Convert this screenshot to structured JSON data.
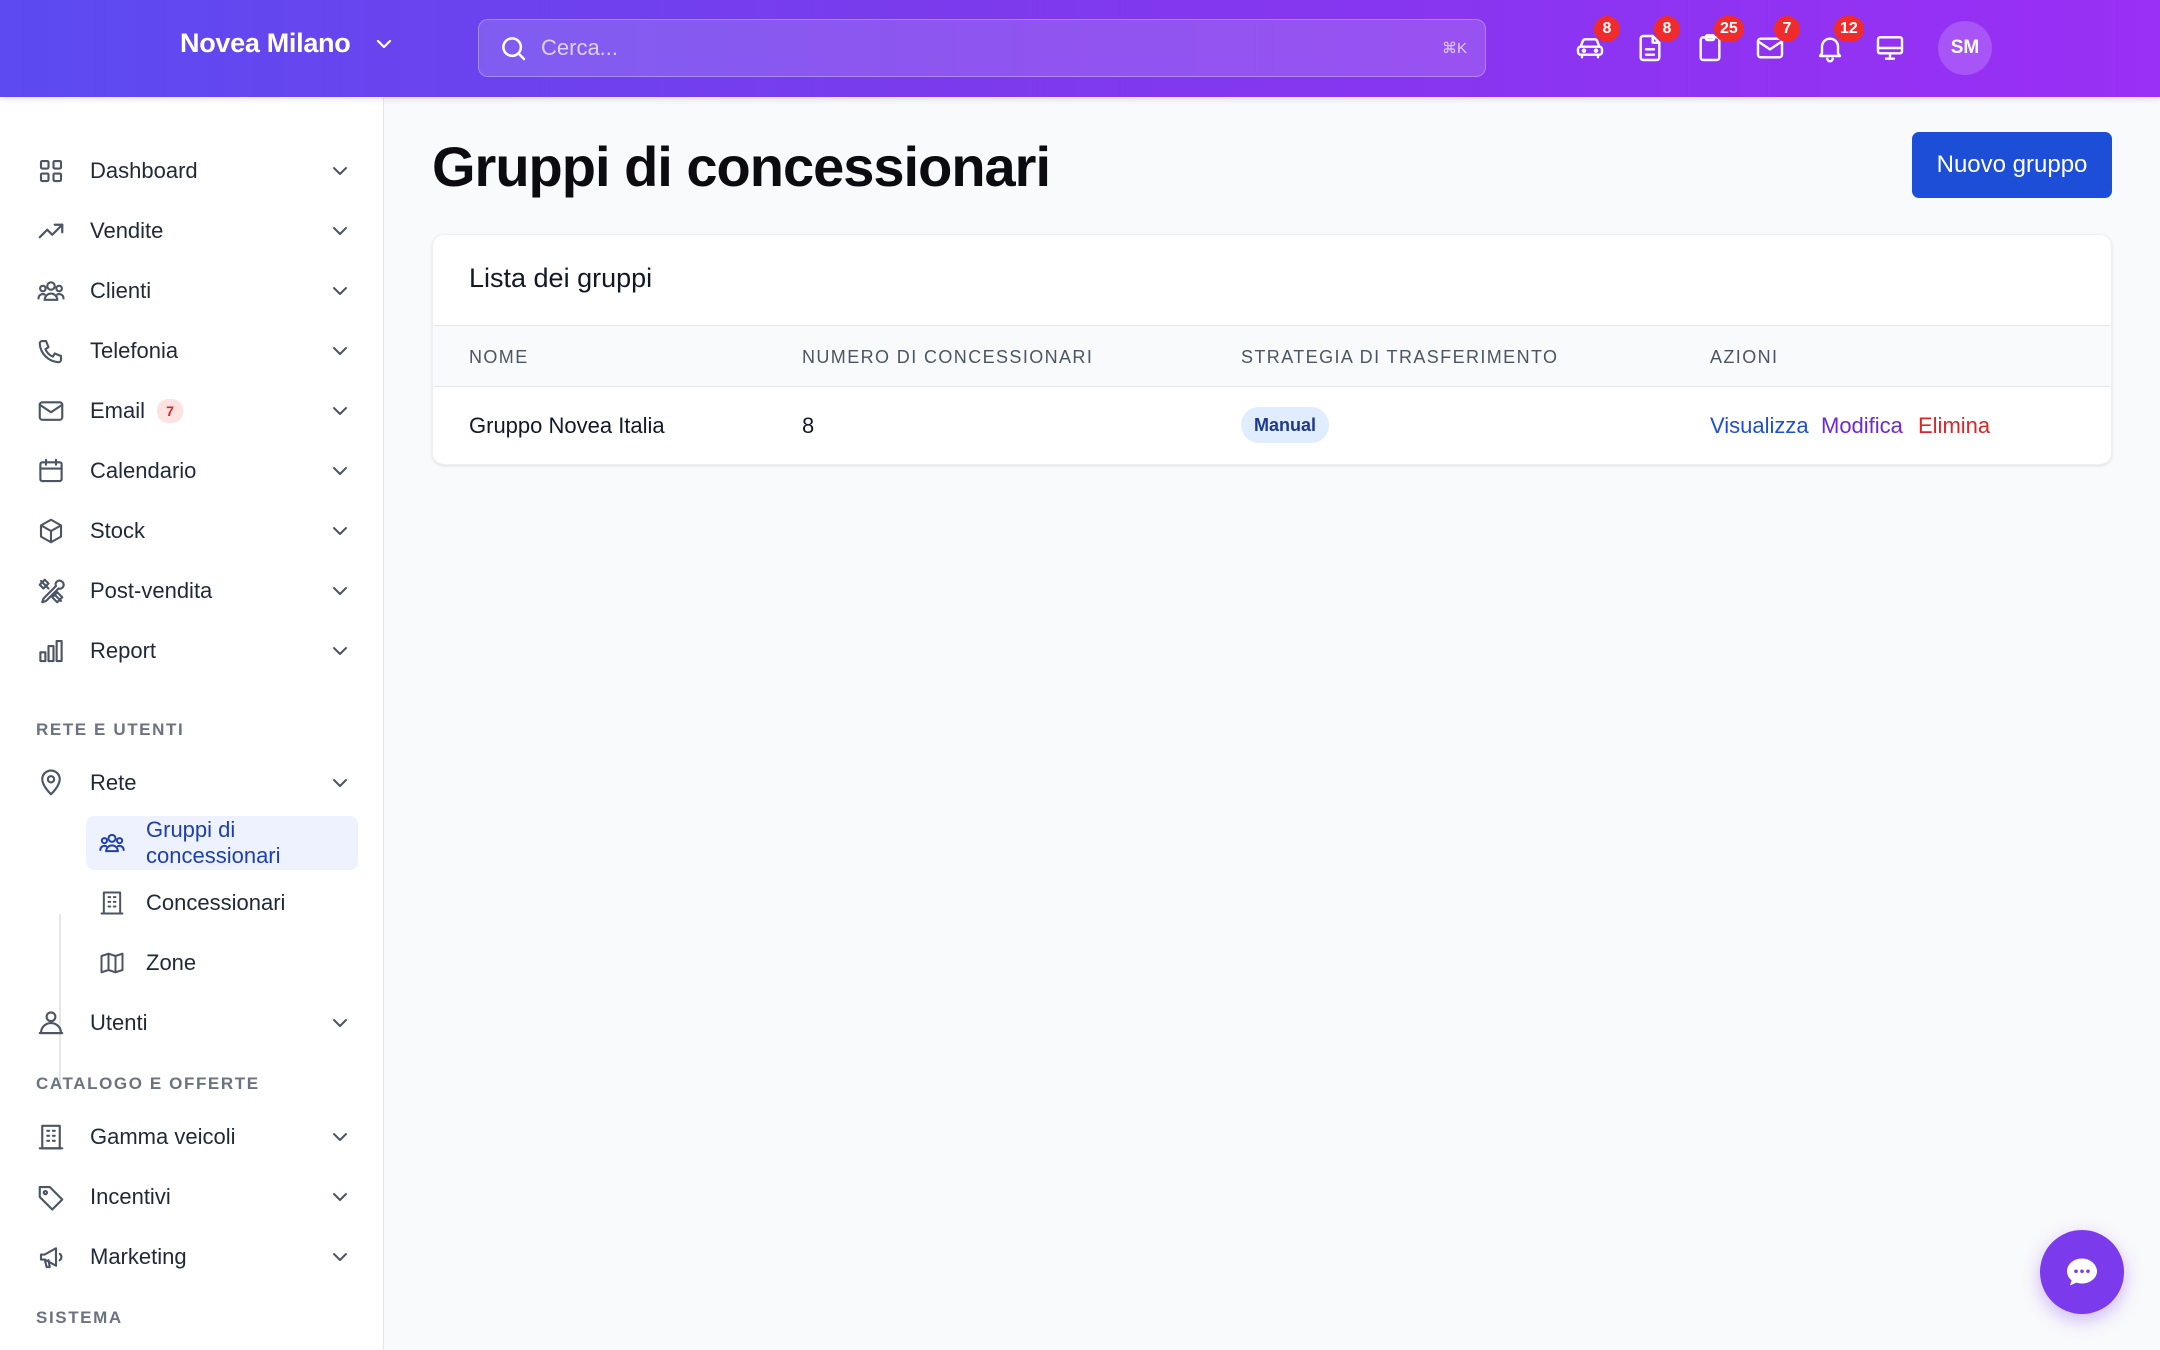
{
  "header": {
    "org_name": "Novea Milano",
    "search_placeholder": "Cerca...",
    "search_shortcut": "⌘K",
    "icons": [
      {
        "name": "car-icon",
        "badge": "8"
      },
      {
        "name": "document-icon",
        "badge": "8"
      },
      {
        "name": "clipboard-icon",
        "badge": "25"
      },
      {
        "name": "mail-icon",
        "badge": "7"
      },
      {
        "name": "bell-icon",
        "badge": "12"
      },
      {
        "name": "monitor-icon",
        "badge": ""
      }
    ],
    "avatar_initials": "SM"
  },
  "sidebar": {
    "items": [
      {
        "label": "Dashboard",
        "icon": "grid-icon"
      },
      {
        "label": "Vendite",
        "icon": "trending-up-icon"
      },
      {
        "label": "Clienti",
        "icon": "users-icon"
      },
      {
        "label": "Telefonia",
        "icon": "phone-icon"
      },
      {
        "label": "Email",
        "icon": "mail-icon",
        "badge": "7"
      },
      {
        "label": "Calendario",
        "icon": "calendar-icon"
      },
      {
        "label": "Stock",
        "icon": "cube-icon"
      },
      {
        "label": "Post-vendita",
        "icon": "tools-icon"
      },
      {
        "label": "Report",
        "icon": "bar-chart-icon"
      }
    ],
    "section_rete": "RETE E UTENTI",
    "rete": {
      "label": "Rete",
      "icon": "map-pin-icon"
    },
    "rete_sub": [
      {
        "label": "Gruppi di concessionari",
        "icon": "users-icon",
        "active": true
      },
      {
        "label": "Concessionari",
        "icon": "building-icon"
      },
      {
        "label": "Zone",
        "icon": "map-icon"
      }
    ],
    "utenti": {
      "label": "Utenti",
      "icon": "user-icon"
    },
    "section_catalogo": "CATALOGO E OFFERTE",
    "catalogo": [
      {
        "label": "Gamma veicoli",
        "icon": "building-icon"
      },
      {
        "label": "Incentivi",
        "icon": "tag-icon"
      },
      {
        "label": "Marketing",
        "icon": "megaphone-icon"
      }
    ],
    "section_sistema": "SISTEMA"
  },
  "main": {
    "title": "Gruppi di concessionari",
    "new_button": "Nuovo gruppo",
    "card_title": "Lista dei gruppi",
    "columns": [
      "NOME",
      "NUMERO DI CONCESSIONARI",
      "STRATEGIA DI TRASFERIMENTO",
      "AZIONI"
    ],
    "rows": [
      {
        "nome": "Gruppo Novea Italia",
        "numero": "8",
        "strategia": "Manual",
        "azioni": [
          "Visualizza",
          "Modifica",
          "Elimina"
        ]
      }
    ]
  },
  "colors": {
    "accent": "#1d4ed8",
    "link_view": "#1d4ed8",
    "link_edit": "#6d28d9",
    "link_delete": "#dc2626",
    "badge_red": "#ef2b2b",
    "header_gradient_start": "#5b4bf0",
    "header_gradient_end": "#9a2ff5"
  }
}
